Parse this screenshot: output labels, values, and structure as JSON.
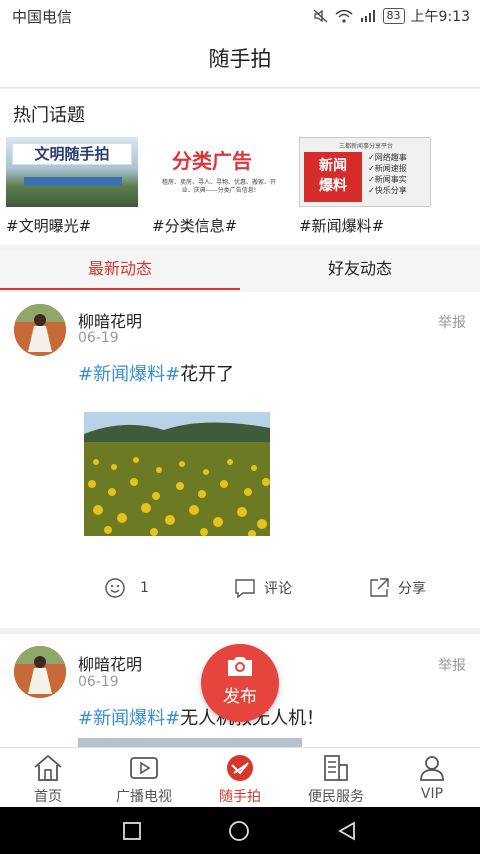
{
  "status_bar": {
    "carrier": "中国电信",
    "battery": "83",
    "time": "上午9:13"
  },
  "header": {
    "title": "随手拍"
  },
  "hot_topics": {
    "title": "热门话题",
    "items": [
      {
        "banner": "文明随手拍",
        "label": "#文明曝光#"
      },
      {
        "banner": "分类广告",
        "sub": "租房、卖房、寻人、寻物、优惠、搬家、开业、庆典——分类广告信息!",
        "label": "#分类信息#"
      },
      {
        "banner_line1": "新闻",
        "banner_line2": "爆料",
        "top_line": "三都新闻事分享平台",
        "checks": [
          "网络趣事",
          "新闻速报",
          "新闻事实",
          "快乐分享"
        ],
        "label": "#新闻爆料#"
      }
    ]
  },
  "tabs": {
    "latest": "最新动态",
    "friends": "好友动态"
  },
  "posts": [
    {
      "user": "柳暗花明",
      "date": "06-19",
      "report": "举报",
      "tag": "#新闻爆料#",
      "text": "花开了",
      "likes": "1",
      "comment": "评论",
      "share": "分享"
    },
    {
      "user": "柳暗花明",
      "date": "06-19",
      "report": "举报",
      "tag": "#新闻爆料#",
      "text": "无人机救无人机！"
    }
  ],
  "publish": {
    "label": "发布"
  },
  "bottom_nav": [
    {
      "label": "首页",
      "icon": "home-icon"
    },
    {
      "label": "广播电视",
      "icon": "play-icon"
    },
    {
      "label": "随手拍",
      "icon": "snap-icon"
    },
    {
      "label": "便民服务",
      "icon": "service-icon"
    },
    {
      "label": "VIP",
      "icon": "user-icon"
    }
  ],
  "colors": {
    "accent": "#d6372c",
    "tag": "#3a8ed8",
    "publish": "#e5453c"
  }
}
